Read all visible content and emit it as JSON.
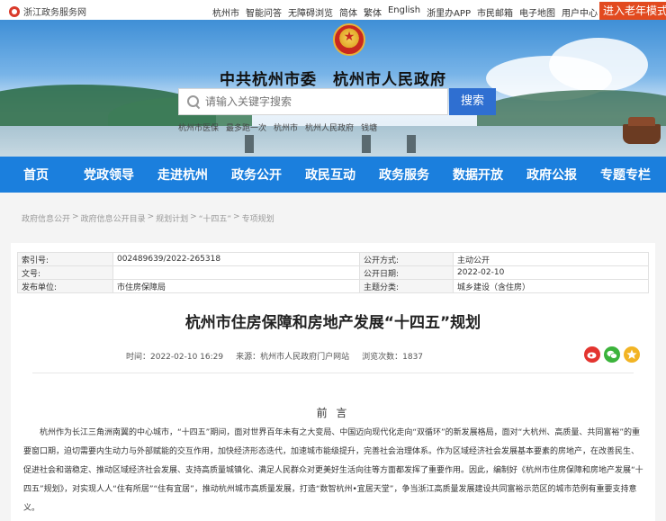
{
  "topbar": {
    "brand": "浙江政务服务网",
    "links": [
      "杭州市",
      "智能问答",
      "无障碍浏览",
      "简体",
      "繁体",
      "English",
      "浙里办APP",
      "市民邮箱",
      "电子地图",
      "用户中心"
    ],
    "elder_button": "进入老年模式"
  },
  "header": {
    "site_title": "中共杭州市委　杭州市人民政府",
    "search_placeholder": "请输入关键字搜索",
    "search_button": "搜索",
    "hot_words": [
      "杭州市医保",
      "最多跑一次",
      "杭州市",
      "杭州人民政府",
      "钱塘"
    ]
  },
  "nav": {
    "items": [
      "首页",
      "党政领导",
      "走进杭州",
      "政务公开",
      "政民互动",
      "政务服务",
      "数据开放",
      "政府公报",
      "专题专栏"
    ]
  },
  "breadcrumb": [
    "政府信息公开",
    "政府信息公开目录",
    "规划计划",
    "“十四五”",
    "专项规划"
  ],
  "meta": {
    "index_label": "索引号:",
    "index_value": "002489639/2022-265318",
    "method_label": "公开方式:",
    "method_value": "主动公开",
    "docno_label": "文号:",
    "docno_value": "",
    "date_label": "公开日期:",
    "date_value": "2022-02-10",
    "publisher_label": "发布单位:",
    "publisher_value": "市住房保障局",
    "topic_label": "主题分类:",
    "topic_value": "城乡建设（含住房）"
  },
  "document": {
    "title": "杭州市住房保障和房地产发展“十四五”规划",
    "time": "时间：2022-02-10 16:29",
    "source": "来源：杭州市人民政府门户网站",
    "views": "浏览次数：1837",
    "share_icons": [
      "weibo-icon",
      "wechat-icon",
      "qzone-icon"
    ],
    "section_title": "前 言",
    "paragraph": "杭州作为长江三角洲南翼的中心城市，“十四五”期间，面对世界百年未有之大变局、中国迈向现代化走向“双循环”的新发展格局，面对“大杭州、高质量、共同富裕”的重要窗口期，迫切需要内生动力与外部赋能的交互作用，加快经济形态迭代，加速城市能级提升，完善社会治理体系。作为区域经济社会发展基本要素的房地产，在改善民生、促进社会和谐稳定、推动区域经济社会发展、支持高质量城镇化、满足人民群众对更美好生活向往等方面都发挥了重要作用。因此，编制好《杭州市住房保障和房地产发展“十四五”规划》，对实现人人“住有所居”“住有宜居”，推动杭州城市高质量发展，打造“数智杭州•宜居天堂”，争当浙江高质量发展建设共同富裕示范区的城市范例有重要支持意义。"
  },
  "colors": {
    "nav_bg": "#1b7fdd",
    "search_button": "#2f6fd1",
    "elder_button": "#e24a1f"
  }
}
